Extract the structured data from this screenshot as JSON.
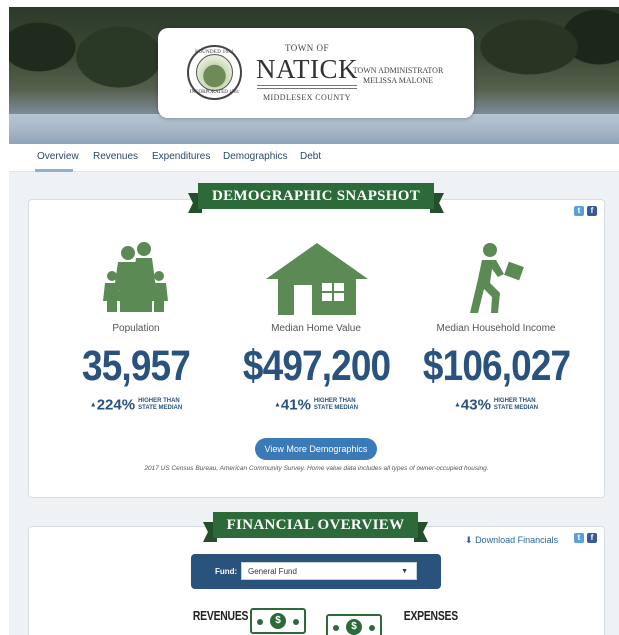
{
  "header": {
    "town_of": "TOWN OF",
    "town_name": "NATICK",
    "county": "MIDDLESEX COUNTY",
    "admin_title": "TOWN ADMINISTRATOR",
    "admin_name": "MELISSA MALONE",
    "seal_top": "FOUNDED 1651",
    "seal_bottom": "INCORPORATED 1781"
  },
  "nav": {
    "tabs": [
      "Overview",
      "Revenues",
      "Expenditures",
      "Demographics",
      "Debt"
    ],
    "active": "Overview"
  },
  "demographics": {
    "ribbon": "DEMOGRAPHIC SNAPSHOT",
    "stats": [
      {
        "icon": "family-icon",
        "label": "Population",
        "value": "35,957",
        "pct": "224%",
        "comparison_top": "HIGHER THAN",
        "comparison_bottom": "STATE MEDIAN"
      },
      {
        "icon": "house-icon",
        "label": "Median Home Value",
        "value": "$497,200",
        "pct": "41%",
        "comparison_top": "HIGHER THAN",
        "comparison_bottom": "STATE MEDIAN"
      },
      {
        "icon": "walking-person-icon",
        "label": "Median Household Income",
        "value": "$106,027",
        "pct": "43%",
        "comparison_top": "HIGHER THAN",
        "comparison_bottom": "STATE MEDIAN"
      }
    ],
    "button": "View More Demographics",
    "footnote": "2017 US Census Bureau, American Community Survey. Home value data includes all types of owner-occupied housing."
  },
  "financial": {
    "ribbon": "FINANCIAL OVERVIEW",
    "download": "Download Financials",
    "fund_label": "Fund:",
    "fund_value": "General Fund",
    "revenues": "REVENUES",
    "expenses": "EXPENSES"
  },
  "colors": {
    "accent_blue": "#29527d",
    "ribbon_green": "#2d6a3a",
    "button_blue": "#3a7ab7"
  }
}
